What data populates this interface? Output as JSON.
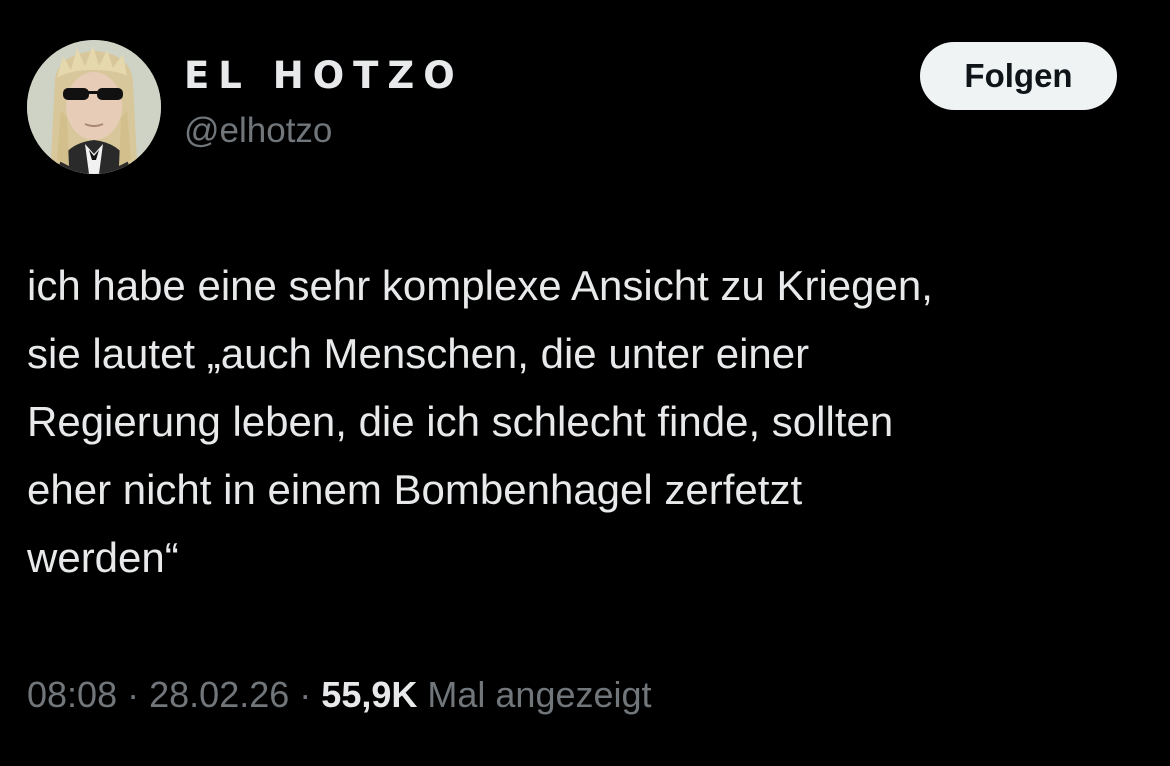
{
  "author": {
    "display_name": "EL HOTZO",
    "handle": "@elhotzo"
  },
  "follow_button": {
    "label": "Folgen"
  },
  "tweet": {
    "lines": [
      "ich habe eine sehr komplexe Ansicht zu Kriegen,",
      "sie lautet „auch Menschen, die unter einer",
      "Regierung leben, die ich schlecht finde, sollten",
      "eher nicht in einem Bombenhagel zerfetzt",
      "werden“"
    ]
  },
  "meta": {
    "time": "08:08",
    "separator": "·",
    "date": "28.02.26",
    "views_count": "55,9K",
    "views_label": "Mal angezeigt"
  },
  "colors": {
    "background": "#000000",
    "text_primary": "#e7e9ea",
    "text_secondary": "#71767b",
    "button_bg": "#eff3f4",
    "button_text": "#0f1419"
  }
}
